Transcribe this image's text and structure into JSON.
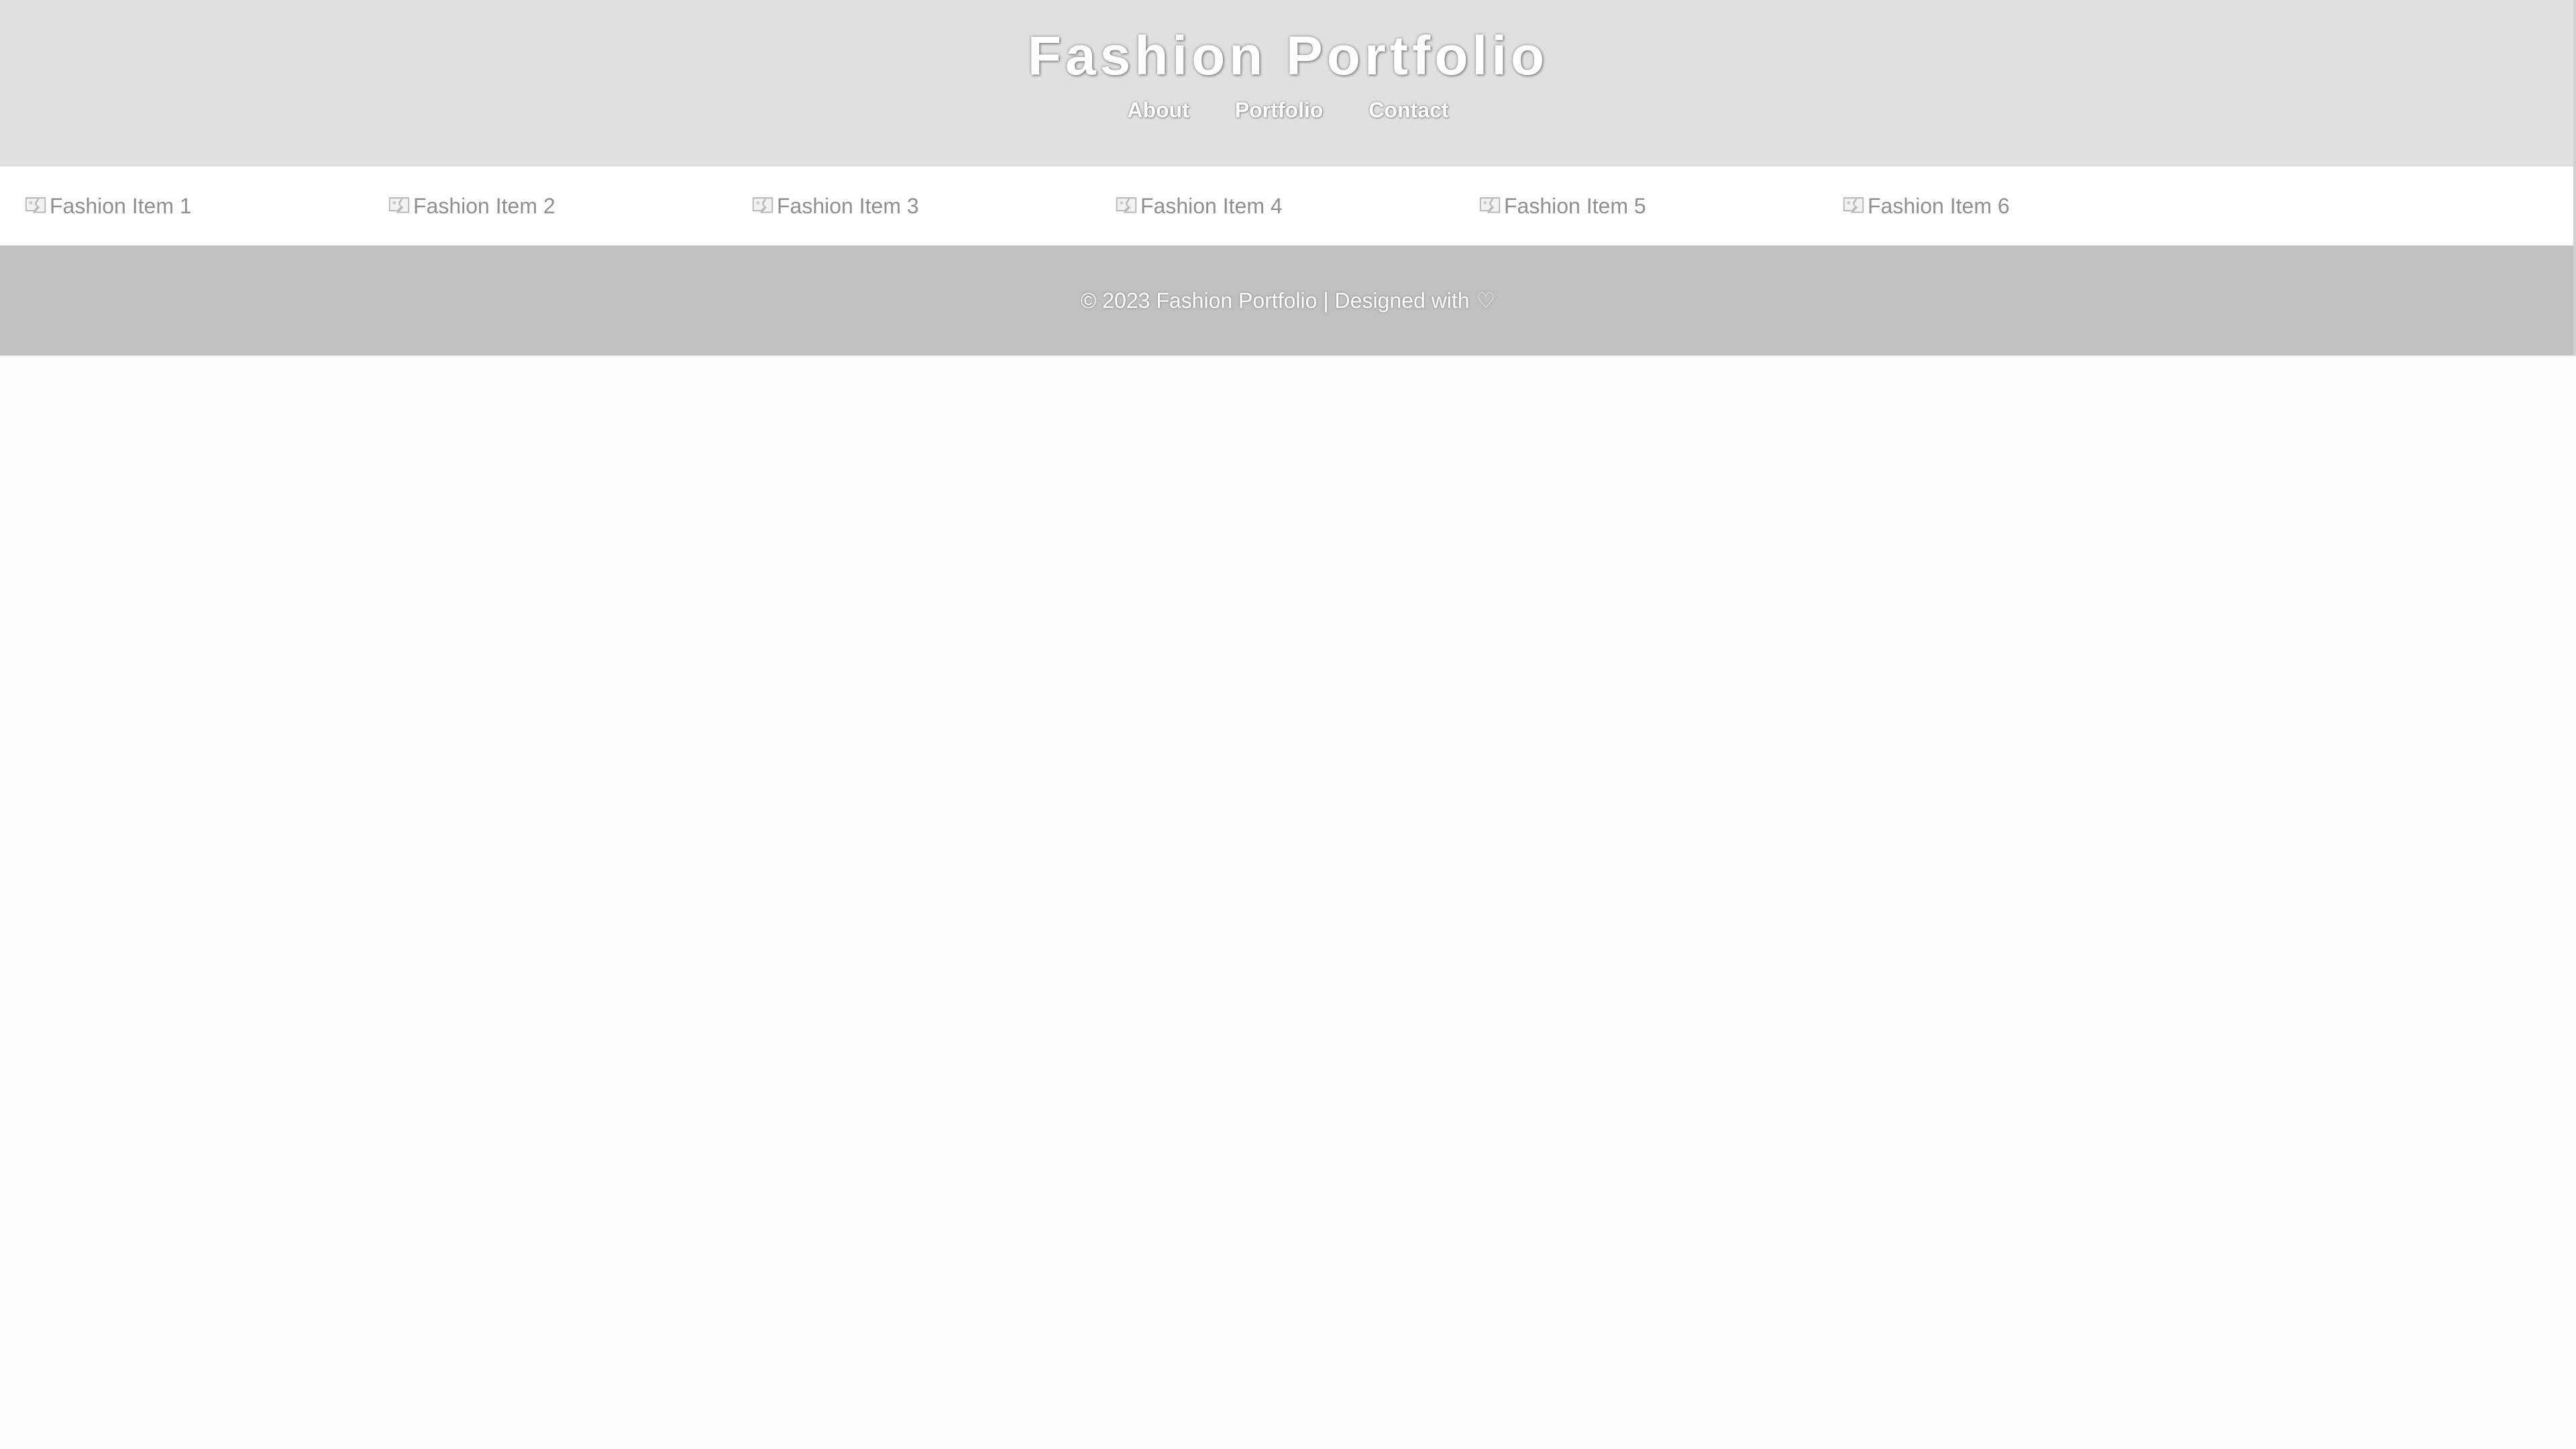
{
  "header": {
    "title": "Fashion Portfolio",
    "nav": [
      {
        "label": "About"
      },
      {
        "label": "Portfolio"
      },
      {
        "label": "Contact"
      }
    ]
  },
  "gallery": {
    "items": [
      {
        "alt": "Fashion Item 1",
        "icon": "broken-image-icon"
      },
      {
        "alt": "Fashion Item 2",
        "icon": "broken-image-icon"
      },
      {
        "alt": "Fashion Item 3",
        "icon": "broken-image-icon"
      },
      {
        "alt": "Fashion Item 4",
        "icon": "broken-image-icon"
      },
      {
        "alt": "Fashion Item 5",
        "icon": "broken-image-icon"
      },
      {
        "alt": "Fashion Item 6",
        "icon": "broken-image-icon"
      }
    ]
  },
  "footer": {
    "text": "© 2023 Fashion Portfolio | Designed with",
    "heart": "♡"
  },
  "colors": {
    "header_bg": "#e0e0e0",
    "footer_bg": "#c0c0c0",
    "text_on_dark": "#ffffff"
  }
}
